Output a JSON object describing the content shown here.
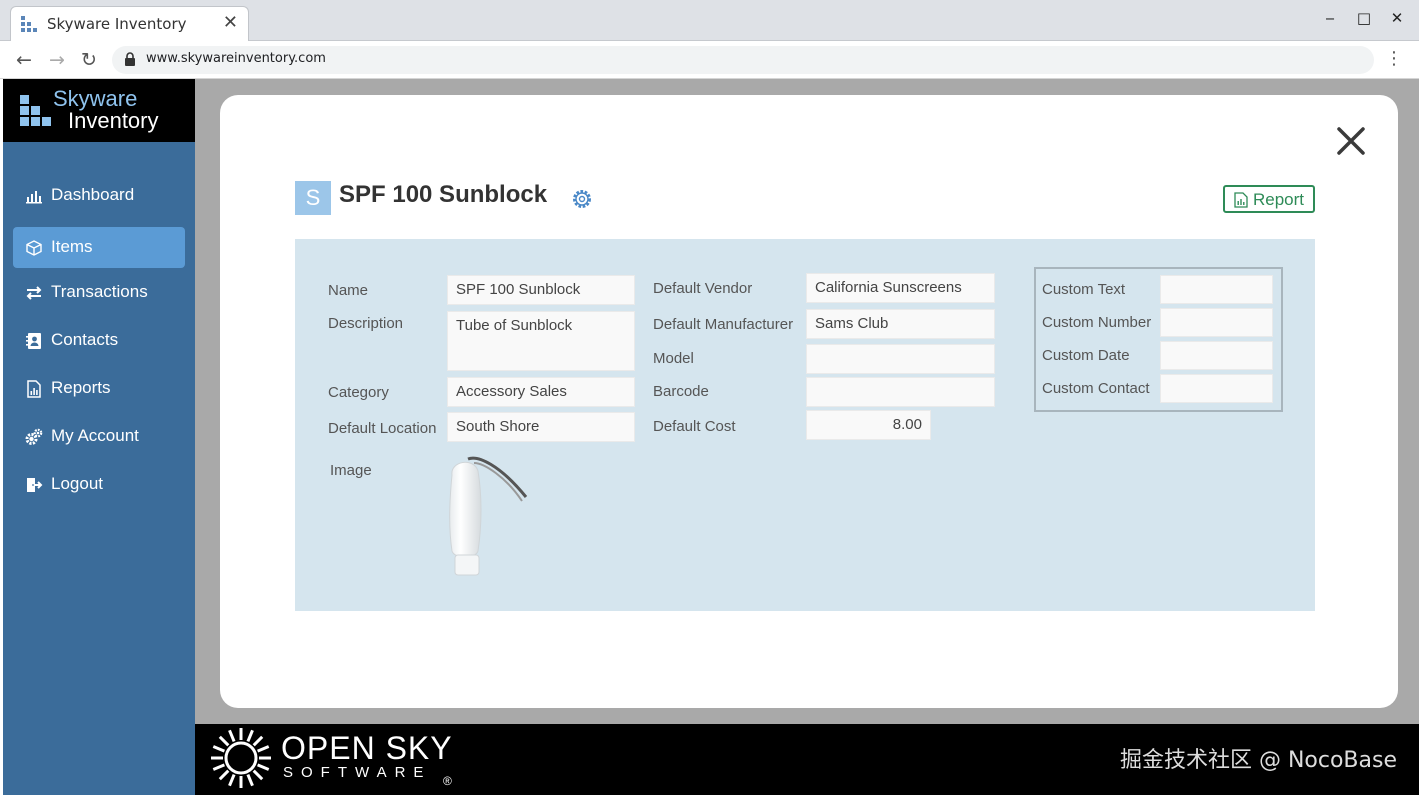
{
  "browser": {
    "tab_title": "Skyware Inventory",
    "tab_close": "✕",
    "url": "www.skywareinventory.com",
    "window_controls": {
      "minimize": "‒",
      "maximize": "□",
      "close": "✕"
    },
    "nav": {
      "back": "←",
      "forward": "→",
      "reload": "↻",
      "menu": "⋮"
    }
  },
  "brand": {
    "line1": "Skyware",
    "line2": "Inventory"
  },
  "sidebar": {
    "items": [
      {
        "label": "Dashboard",
        "icon": "bar-chart-icon",
        "active": false
      },
      {
        "label": "Items",
        "icon": "box-icon",
        "active": true
      },
      {
        "label": "Transactions",
        "icon": "exchange-icon",
        "active": false
      },
      {
        "label": "Contacts",
        "icon": "address-book-icon",
        "active": false
      },
      {
        "label": "Reports",
        "icon": "report-icon",
        "active": false
      },
      {
        "label": "My Account",
        "icon": "cogs-icon",
        "active": false
      },
      {
        "label": "Logout",
        "icon": "sign-out-icon",
        "active": false
      }
    ]
  },
  "item": {
    "badge": "S",
    "title": "SPF 100 Sunblock",
    "report_label": "Report",
    "fields": {
      "name": {
        "label": "Name",
        "value": "SPF 100 Sunblock"
      },
      "description": {
        "label": "Description",
        "value": "Tube of Sunblock"
      },
      "category": {
        "label": "Category",
        "value": "Accessory Sales"
      },
      "default_location": {
        "label": "Default Location",
        "value": "South Shore"
      },
      "image": {
        "label": "Image"
      },
      "default_vendor": {
        "label": "Default Vendor",
        "value": "California Sunscreens"
      },
      "default_manufacturer": {
        "label": "Default Manufacturer",
        "value": "Sams Club"
      },
      "model": {
        "label": "Model",
        "value": ""
      },
      "barcode": {
        "label": "Barcode",
        "value": ""
      },
      "default_cost": {
        "label": "Default Cost",
        "value": "8.00"
      },
      "custom_text": {
        "label": "Custom Text",
        "value": ""
      },
      "custom_number": {
        "label": "Custom Number",
        "value": ""
      },
      "custom_date": {
        "label": "Custom Date",
        "value": ""
      },
      "custom_contact": {
        "label": "Custom Contact",
        "value": ""
      }
    }
  },
  "footer": {
    "company_line1": "OPEN SKY",
    "company_line2": "SOFTWARE",
    "registered": "®",
    "watermark": "掘金技术社区 @ NocoBase"
  },
  "colors": {
    "sidebar": "#3b6c9a",
    "active_nav": "#5b9bd5",
    "panel": "#d5e5ee",
    "report_accent": "#2e8b57",
    "brand_light": "#8fc3ee"
  }
}
